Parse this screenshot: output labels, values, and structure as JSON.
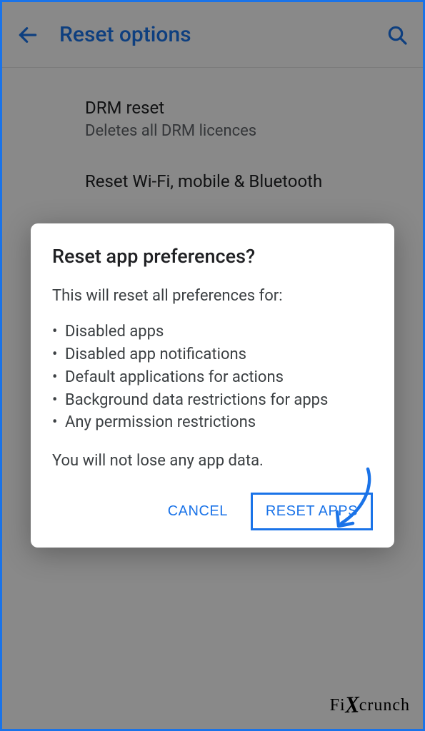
{
  "header": {
    "title": "Reset options"
  },
  "settings": {
    "items": [
      {
        "title": "DRM reset",
        "subtitle": "Deletes all DRM licences"
      },
      {
        "title": "Reset Wi-Fi, mobile & Bluetooth",
        "subtitle": ""
      }
    ]
  },
  "dialog": {
    "title": "Reset app preferences?",
    "intro": "This will reset all preferences for:",
    "bullets": [
      "Disabled apps",
      "Disabled app notifications",
      "Default applications for actions",
      "Background data restrictions for apps",
      "Any permission restrictions"
    ],
    "footer_text": "You will not lose any app data.",
    "cancel_label": "CANCEL",
    "confirm_label": "RESET APPS"
  },
  "watermark": {
    "prefix": "Fi",
    "suffix": "crunch"
  }
}
